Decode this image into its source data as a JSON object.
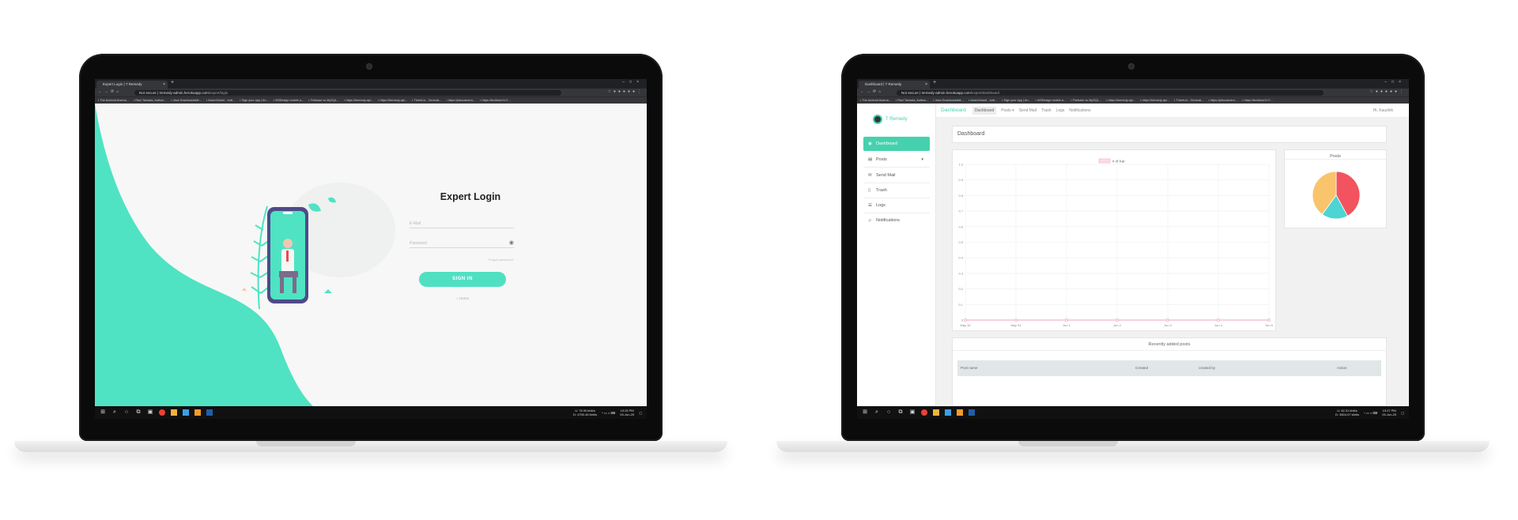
{
  "left": {
    "browser": {
      "tab_title": "Expert Login | T Remedy",
      "url_host": "tremedy-admin.herokuapp.com",
      "url_path": "/expert/login",
      "not_secure": "Not secure",
      "bookmarks": [
        "The Android Arsena...",
        "Ravi Tamada, Authos...",
        "Java Downloadable...",
        "AlvamGared - butt...",
        "Sign your app | An...",
        "W3Design mobile a...",
        "Firebase vs MySQL...",
        "https://tremedy-api...",
        "https://tremedy-api...",
        "ThreeLis - Generat...",
        "https://jsbucamero...",
        "https://techtutorCn7..."
      ]
    },
    "login": {
      "title": "Expert Login",
      "email_placeholder": "E-Mail",
      "password_placeholder": "Password",
      "forgot": "Forgot password?",
      "signin": "SIGN IN",
      "home": "Home"
    },
    "taskbar": {
      "stats1": "U: 76.90 kbit/s",
      "stats2": "D: 4750.46 kbit/s",
      "time": "19:25 PM",
      "date": "03-Jun-20"
    }
  },
  "right": {
    "browser": {
      "tab_title": "Dashboard | T Remedy",
      "url_host": "tremedy-admin.herokuapp.com",
      "url_path": "/expert/dashboard",
      "not_secure": "Not secure",
      "bookmarks": [
        "The Android Arsena...",
        "Ravi Tamada, Authos...",
        "Java Downloadable...",
        "AlvamGared - butt...",
        "Sign your app | An...",
        "W3Design mobile a...",
        "Firebase vs MySQL...",
        "https://tremedy-api...",
        "https://tremedy-api...",
        "ThreeLis - Generat...",
        "https://jsbucamero...",
        "https://techtutorCn7..."
      ]
    },
    "sidebar": {
      "brand": "T Remedy",
      "items": [
        {
          "label": "Dashboard"
        },
        {
          "label": "Posts"
        },
        {
          "label": "Send Mail"
        },
        {
          "label": "Trash"
        },
        {
          "label": "Logs"
        },
        {
          "label": "Notifications"
        }
      ]
    },
    "topnav": {
      "brand": "Dashboard",
      "links": [
        "Dashboard",
        "Posts",
        "Send Mail",
        "Trash",
        "Logs",
        "Notifications"
      ],
      "greeting": "Hi, Kaushik"
    },
    "page_title": "Dashboard",
    "recent_title": "Recently added posts",
    "table_headers": [
      "Post name",
      "Created",
      "created by",
      "Action"
    ],
    "pie_title": "Posts",
    "taskbar": {
      "stats1": "U: 62.31 kbit/s",
      "stats2": "D: 3504.07 kbit/s",
      "time": "19:27 PM",
      "date": "03-Jun-20"
    }
  },
  "chart_data": [
    {
      "type": "line",
      "legend": [
        "# of Kar"
      ],
      "x": [
        "May 30",
        "May 31",
        "Jun 1",
        "Jun 2",
        "Jun 3",
        "Jun 4",
        "Jun 5"
      ],
      "series": [
        {
          "name": "# of Kar",
          "values": [
            0,
            0,
            0,
            0,
            0,
            0,
            0
          ]
        }
      ],
      "ylim": [
        0,
        1.0
      ],
      "yticks": [
        1.0,
        0.9,
        0.8,
        0.7,
        0.6,
        0.5,
        0.4,
        0.3,
        0.2,
        0.1,
        0
      ],
      "grid": true,
      "colors": {
        "line": "#f4a0b5"
      }
    },
    {
      "type": "pie",
      "title": "Posts",
      "slices": [
        {
          "value": 0.42,
          "color": "#f2535f"
        },
        {
          "value": 0.18,
          "color": "#4dd4d4"
        },
        {
          "value": 0.4,
          "color": "#f9c46b"
        }
      ]
    }
  ]
}
